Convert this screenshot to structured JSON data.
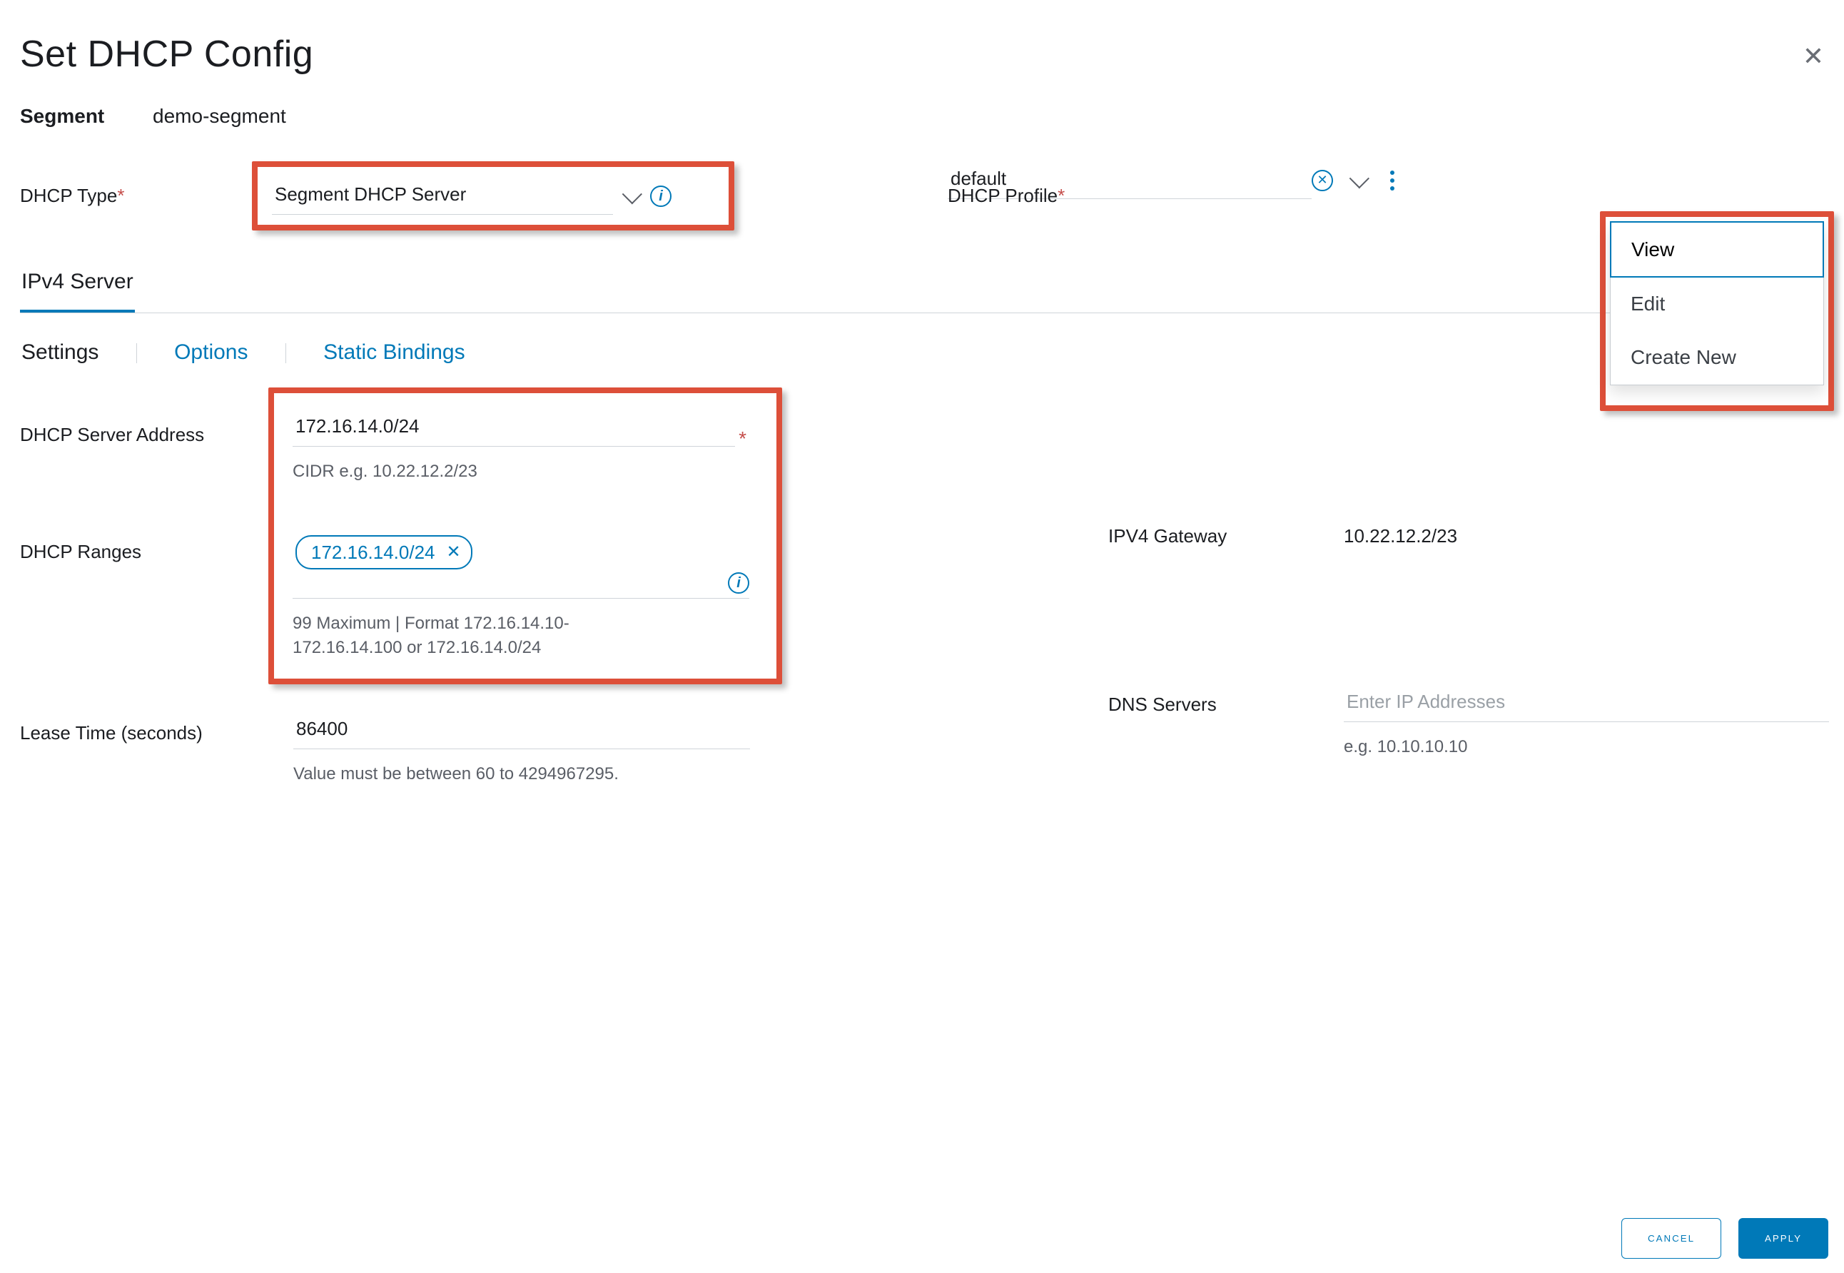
{
  "dialog": {
    "title": "Set DHCP Config",
    "segment_label": "Segment",
    "segment_value": "demo-segment"
  },
  "dhcp_type": {
    "label": "DHCP Type",
    "value": "Segment DHCP Server"
  },
  "dhcp_profile": {
    "label": "DHCP Profile",
    "value": "default",
    "menu": {
      "view": "View",
      "edit": "Edit",
      "create": "Create New"
    }
  },
  "tabs1": {
    "ipv4": "IPv4 Server"
  },
  "tabs2": {
    "settings": "Settings",
    "options": "Options",
    "static": "Static Bindings"
  },
  "server_addr": {
    "label": "DHCP Server Address",
    "value": "172.16.14.0/24",
    "hint": "CIDR e.g. 10.22.12.2/23"
  },
  "ranges": {
    "label": "DHCP Ranges",
    "chip": "172.16.14.0/24",
    "hint": "99 Maximum | Format 172.16.14.10-172.16.14.100 or 172.16.14.0/24"
  },
  "gateway": {
    "label": "IPV4 Gateway",
    "value": "10.22.12.2/23"
  },
  "lease": {
    "label": "Lease Time (seconds)",
    "value": "86400",
    "hint": "Value must be between 60 to 4294967295."
  },
  "dns": {
    "label": "DNS Servers",
    "placeholder": "Enter IP Addresses",
    "hint": "e.g. 10.10.10.10"
  },
  "footer": {
    "cancel": "CANCEL",
    "apply": "APPLY"
  }
}
